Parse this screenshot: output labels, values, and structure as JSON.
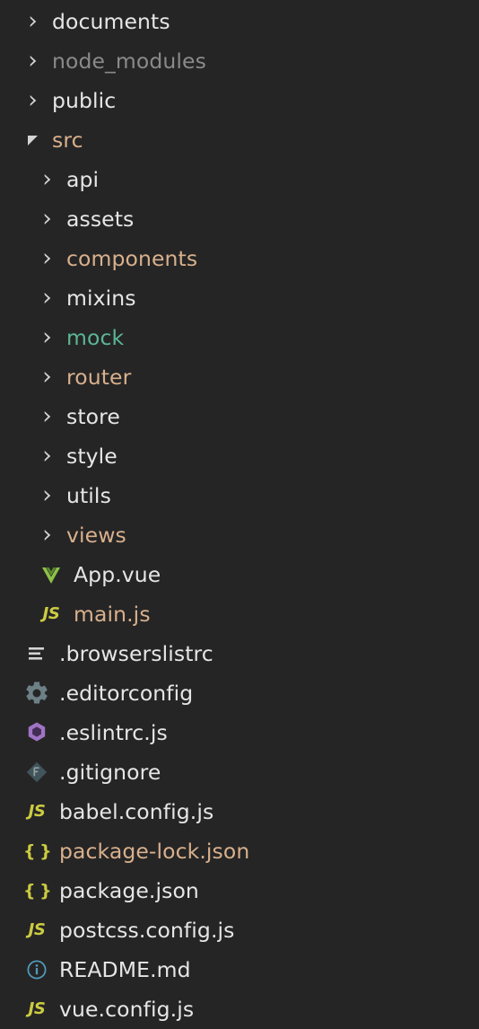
{
  "panel": {
    "name": "file-explorer-tree",
    "background": "#252526",
    "theme": "dark"
  },
  "colors": {
    "default_text": "#e6e6e6",
    "ignored_text": "#8a8a8a",
    "modified_text": "#d9b08c",
    "added_text": "#5bb694",
    "js_icon": "#cbcb41",
    "vue_icon": "#8dc149",
    "eslint_icon": "#a074c4",
    "gear_icon": "#6d8086",
    "git_icon": "#41535b",
    "info_icon": "#519aba",
    "list_icon": "#d4d4d4"
  },
  "tree": {
    "items": [
      {
        "name": "documents",
        "type": "folder",
        "indent": 0,
        "expanded": false,
        "status": "default",
        "icon": "chevron-right-icon"
      },
      {
        "name": "node_modules",
        "type": "folder",
        "indent": 0,
        "expanded": false,
        "status": "ignored",
        "icon": "chevron-right-icon"
      },
      {
        "name": "public",
        "type": "folder",
        "indent": 0,
        "expanded": false,
        "status": "default",
        "icon": "chevron-right-icon"
      },
      {
        "name": "src",
        "type": "folder",
        "indent": 0,
        "expanded": true,
        "status": "modified",
        "icon": "chevron-down-icon"
      },
      {
        "name": "api",
        "type": "folder",
        "indent": 1,
        "expanded": false,
        "status": "default",
        "icon": "chevron-right-icon"
      },
      {
        "name": "assets",
        "type": "folder",
        "indent": 1,
        "expanded": false,
        "status": "default",
        "icon": "chevron-right-icon"
      },
      {
        "name": "components",
        "type": "folder",
        "indent": 1,
        "expanded": false,
        "status": "modified",
        "icon": "chevron-right-icon"
      },
      {
        "name": "mixins",
        "type": "folder",
        "indent": 1,
        "expanded": false,
        "status": "default",
        "icon": "chevron-right-icon"
      },
      {
        "name": "mock",
        "type": "folder",
        "indent": 1,
        "expanded": false,
        "status": "added",
        "icon": "chevron-right-icon"
      },
      {
        "name": "router",
        "type": "folder",
        "indent": 1,
        "expanded": false,
        "status": "modified",
        "icon": "chevron-right-icon"
      },
      {
        "name": "store",
        "type": "folder",
        "indent": 1,
        "expanded": false,
        "status": "default",
        "icon": "chevron-right-icon"
      },
      {
        "name": "style",
        "type": "folder",
        "indent": 1,
        "expanded": false,
        "status": "default",
        "icon": "chevron-right-icon"
      },
      {
        "name": "utils",
        "type": "folder",
        "indent": 1,
        "expanded": false,
        "status": "default",
        "icon": "chevron-right-icon"
      },
      {
        "name": "views",
        "type": "folder",
        "indent": 1,
        "expanded": false,
        "status": "modified",
        "icon": "chevron-right-icon"
      },
      {
        "name": "App.vue",
        "type": "file",
        "indent": 1,
        "status": "default",
        "icon": "vue-file-icon"
      },
      {
        "name": "main.js",
        "type": "file",
        "indent": 1,
        "status": "modified",
        "icon": "js-file-icon"
      },
      {
        "name": ".browserslistrc",
        "type": "file",
        "indent": 0,
        "status": "default",
        "icon": "list-file-icon"
      },
      {
        "name": ".editorconfig",
        "type": "file",
        "indent": 0,
        "status": "default",
        "icon": "gear-file-icon"
      },
      {
        "name": ".eslintrc.js",
        "type": "file",
        "indent": 0,
        "status": "default",
        "icon": "eslint-file-icon"
      },
      {
        "name": ".gitignore",
        "type": "file",
        "indent": 0,
        "status": "default",
        "icon": "git-file-icon"
      },
      {
        "name": "babel.config.js",
        "type": "file",
        "indent": 0,
        "status": "default",
        "icon": "js-file-icon"
      },
      {
        "name": "package-lock.json",
        "type": "file",
        "indent": 0,
        "status": "modified",
        "icon": "json-file-icon"
      },
      {
        "name": "package.json",
        "type": "file",
        "indent": 0,
        "status": "default",
        "icon": "json-file-icon"
      },
      {
        "name": "postcss.config.js",
        "type": "file",
        "indent": 0,
        "status": "default",
        "icon": "js-file-icon"
      },
      {
        "name": "README.md",
        "type": "file",
        "indent": 0,
        "status": "default",
        "icon": "info-file-icon"
      },
      {
        "name": "vue.config.js",
        "type": "file",
        "indent": 0,
        "status": "default",
        "icon": "js-file-icon"
      }
    ]
  }
}
